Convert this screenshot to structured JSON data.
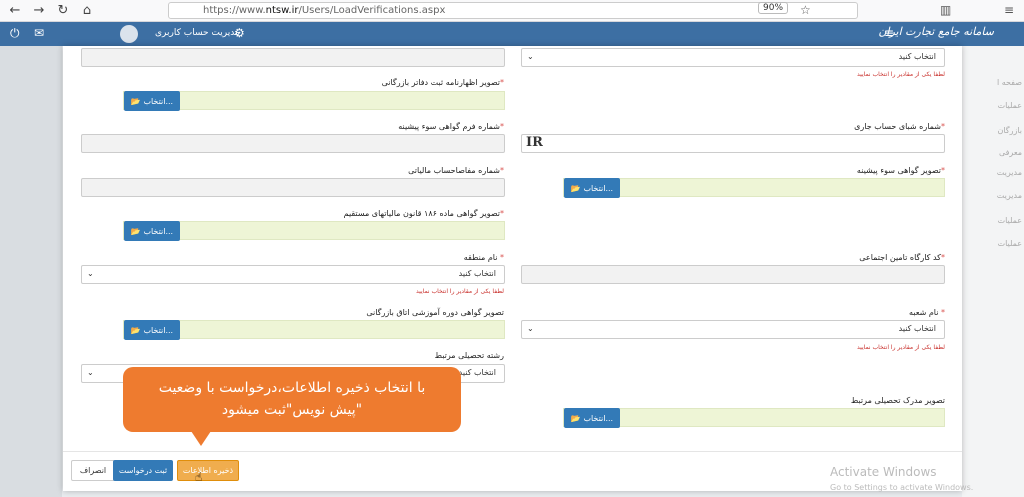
{
  "browser": {
    "url_prefix": "https://www.",
    "url_domain": "ntsw.ir",
    "url_path": "/Users/LoadVerifications.aspx",
    "zoom": "90%"
  },
  "header": {
    "logo_text": "سامانه جامع تجارت ایران",
    "account_label": "مدیریت حساب کاربری"
  },
  "sidebar_right": {
    "items": [
      "صفحه ا",
      "عملیات",
      "بازرگان",
      "معرفی",
      "مدیریت",
      "مدیریت",
      "عملیات",
      "عملیات"
    ]
  },
  "form": {
    "select_placeholder": "انتخاب کنید",
    "upload_button": "انتخاب...",
    "hint_text": "لطفا یکی از مقادیر را انتخاب نمایید",
    "commerce_doc_label": "تصویر اظهارنامه ثبت دفاتر بازرگانی",
    "tax_form_label": "شماره فرم گواهی سوء پیشینه",
    "sheba_label": "شماره شبای حساب جاری",
    "sheba_value": "IR",
    "tax_account_label": "شماره مفاصاحساب مالیاتی",
    "criminal_record_label": "تصویر گواهی سوء پیشینه",
    "article186_label": "تصویر گواهی ماده ۱۸۶ قانون مالیاتهای مستقیم",
    "region_label": "نام منطقه",
    "insurance_label": "کد کارگاه تامین اجتماعی",
    "training_cert_label": "تصویر گواهی دوره آموزشی اتاق بازرگانی",
    "branch_label": "نام شعبه",
    "education_field_label": "رشته تحصیلی مرتبط",
    "education_doc_label": "تصویر مدرک تحصیلی مرتبط"
  },
  "footer": {
    "cancel_label": "انصراف",
    "submit_label": "ثبت درخواست",
    "save_label": "ذخیره اطلاعات"
  },
  "tooltip": {
    "line1": "با انتخاب ذخیره اطلاعات،درخواست با وضعیت",
    "line2": "\"پیش نویس\"ثبت میشود"
  },
  "windows": {
    "activate_title": "Activate Windows",
    "activate_sub": "Go to Settings to activate Windows."
  }
}
